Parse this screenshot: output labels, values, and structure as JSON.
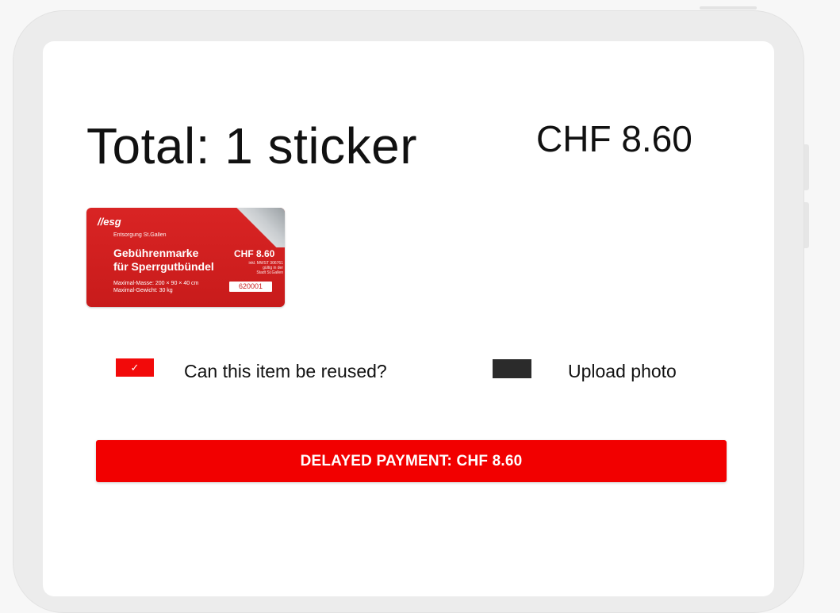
{
  "header": {
    "total_label": "Total: 1 sticker",
    "total_price": "CHF 8.60"
  },
  "sticker": {
    "logo": "esg",
    "logo_sub": "Entsorgung St.Gallen",
    "heading_line1": "Gebührenmarke",
    "heading_line2": "für Sperrgutbündel",
    "price": "CHF 8.60",
    "small_line1": "inkl. MWST 306761",
    "small_line2": "gültig in der",
    "small_line3": "Stadt St.Gallen",
    "dims_line1": "Maximal-Masse: 200 × 90 × 40 cm",
    "dims_line2": "Maximal-Gewicht: 30 kg",
    "serial": "620001"
  },
  "options": {
    "reuse_checked": true,
    "reuse_check_glyph": "✓",
    "reuse_label": "Can this item be reused?",
    "upload_label": "Upload photo"
  },
  "actions": {
    "pay_label": "DELAYED PAYMENT: CHF 8.60"
  },
  "colors": {
    "accent": "#f20000",
    "sticker_red": "#c81b1b",
    "upload_box": "#2b2b2b"
  }
}
